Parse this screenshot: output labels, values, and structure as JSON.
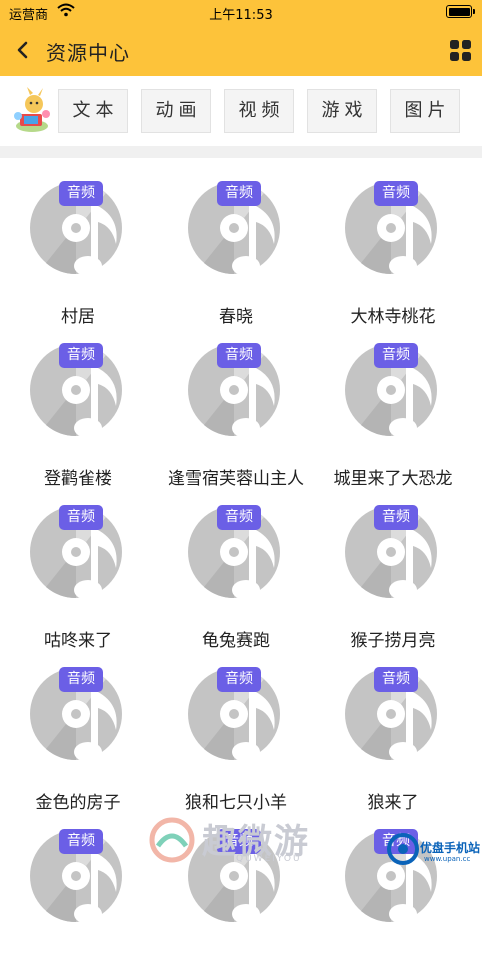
{
  "status_bar": {
    "carrier": "运营商",
    "time": "上午11:53"
  },
  "nav": {
    "title": "资源中心"
  },
  "tabs": [
    "文本",
    "动画",
    "视频",
    "游戏",
    "图片"
  ],
  "badge_label": "音频",
  "items": [
    "村居",
    "春晓",
    "大林寺桃花",
    "登鹳雀楼",
    "逢雪宿芙蓉山主人",
    "城里来了大恐龙",
    "咕咚来了",
    "龟兔赛跑",
    "猴子捞月亮",
    "金色的房子",
    "狼和七只小羊",
    "狼来了",
    "",
    "",
    ""
  ],
  "watermark": {
    "text": "趣微游",
    "sub": "QUWEIYOU",
    "site": "优盘手机站",
    "site_sub": "www.upan.cc"
  },
  "colors": {
    "header": "#fdc33a",
    "badge": "#6b5fe6",
    "disc": "#c4c4c4"
  }
}
